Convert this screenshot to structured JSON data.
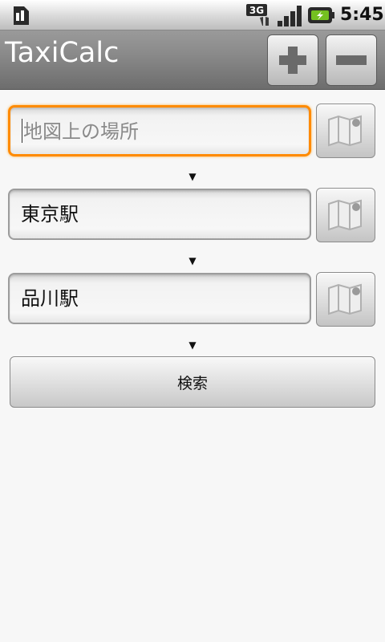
{
  "status_bar": {
    "network_type": "3G",
    "time": "5:45",
    "icons": [
      "sim-card-icon",
      "3g-data-icon",
      "signal-strength-icon",
      "battery-charging-icon"
    ]
  },
  "app": {
    "title": "TaxiCalc",
    "add_button_icon": "plus-icon",
    "remove_button_icon": "minus-icon"
  },
  "route": {
    "origin": {
      "value": "",
      "placeholder": "地図上の場所",
      "map_icon": "map-icon"
    },
    "stops": [
      {
        "value": "東京駅",
        "map_icon": "map-icon"
      },
      {
        "value": "品川駅",
        "map_icon": "map-icon"
      }
    ],
    "arrow_glyph": "▼",
    "search_label": "検索"
  },
  "colors": {
    "focus_border": "#ff8a00",
    "title_bar": "#8a8a8a",
    "background": "#f7f7f7"
  }
}
